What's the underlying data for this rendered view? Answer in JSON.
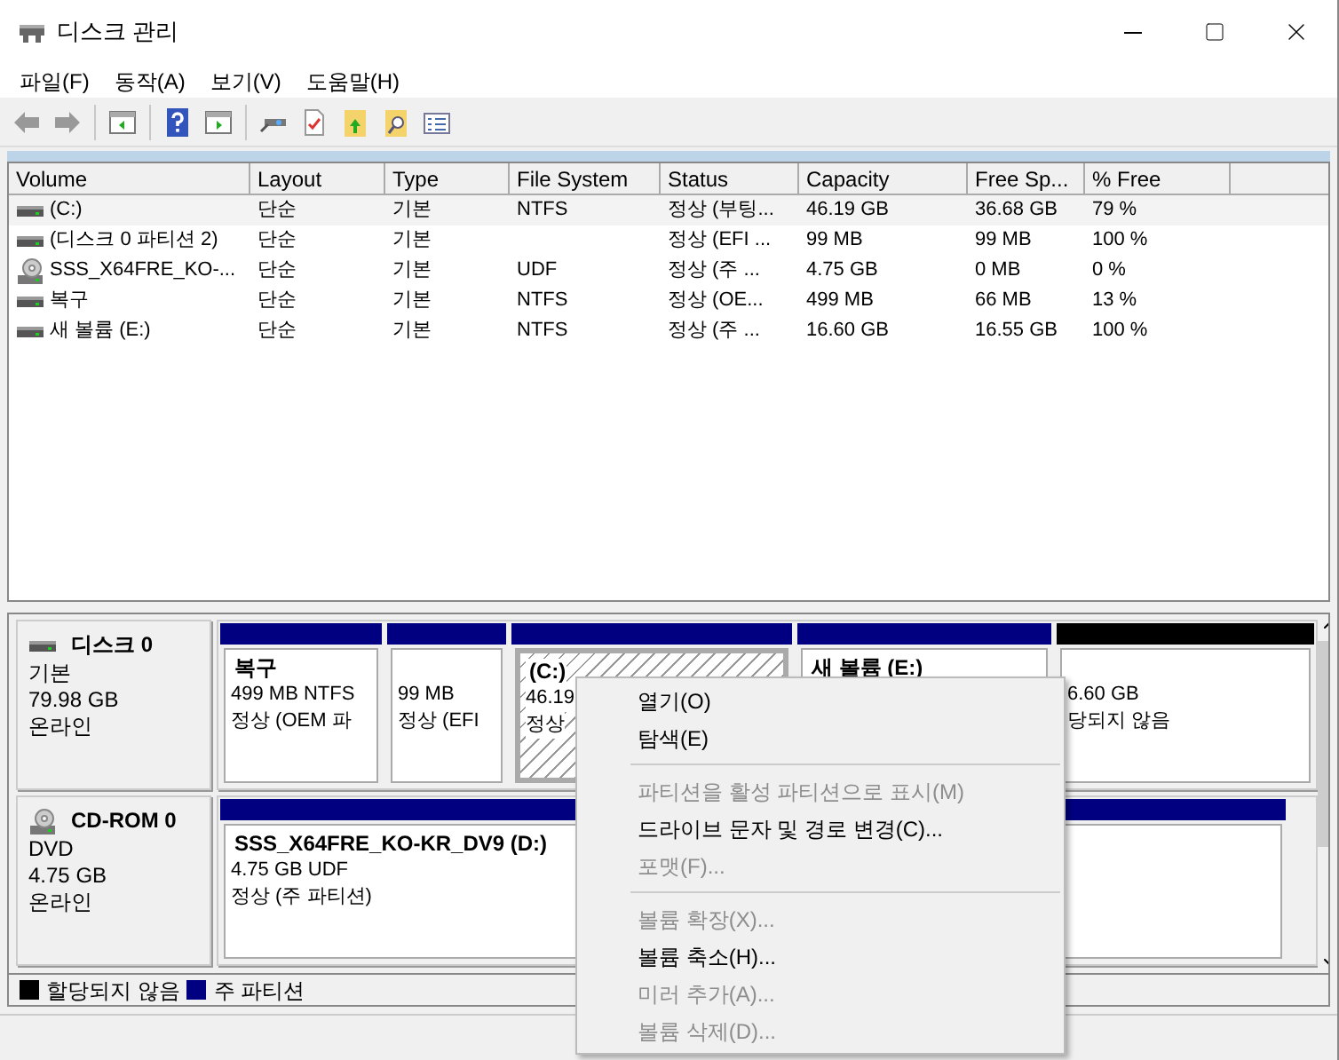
{
  "window": {
    "title": "디스크 관리"
  },
  "menu": [
    "파일(F)",
    "동작(A)",
    "보기(V)",
    "도움말(H)"
  ],
  "table": {
    "columns": [
      "Volume",
      "Layout",
      "Type",
      "File System",
      "Status",
      "Capacity",
      "Free Sp...",
      "% Free"
    ],
    "rows": [
      {
        "kind": "disk",
        "selected": true,
        "cells": [
          "(C:)",
          "단순",
          "기본",
          "NTFS",
          "정상 (부팅...",
          "46.19 GB",
          "36.68 GB",
          "79 %"
        ]
      },
      {
        "kind": "disk",
        "selected": false,
        "cells": [
          "(디스크 0 파티션 2)",
          "단순",
          "기본",
          "",
          "정상 (EFI ...",
          "99 MB",
          "99 MB",
          "100 %"
        ]
      },
      {
        "kind": "cd",
        "selected": false,
        "cells": [
          "SSS_X64FRE_KO-...",
          "단순",
          "기본",
          "UDF",
          "정상 (주 ...",
          "4.75 GB",
          "0 MB",
          "0 %"
        ]
      },
      {
        "kind": "disk",
        "selected": false,
        "cells": [
          "복구",
          "단순",
          "기본",
          "NTFS",
          "정상 (OE...",
          "499 MB",
          "66 MB",
          "13 %"
        ]
      },
      {
        "kind": "disk",
        "selected": false,
        "cells": [
          "새 볼륨 (E:)",
          "단순",
          "기본",
          "NTFS",
          "정상 (주 ...",
          "16.60 GB",
          "16.55 GB",
          "100 %"
        ]
      }
    ]
  },
  "disks": [
    {
      "kind": "disk",
      "name": "디스크 0",
      "type": "기본",
      "size": "79.98 GB",
      "status": "온라인",
      "partitions": [
        {
          "kind": "primary",
          "selected": false,
          "title": "복구",
          "size": "499 MB NTFS",
          "status": "정상 (OEM 파"
        },
        {
          "kind": "primary",
          "selected": false,
          "size": "99 MB",
          "status": "정상 (EFI"
        },
        {
          "kind": "primary",
          "selected": true,
          "title": "(C:)",
          "size": "46.19",
          "status": "정상"
        },
        {
          "kind": "primary",
          "selected": false,
          "title": "새 볼륨 (E:)"
        },
        {
          "kind": "unallocated",
          "selected": false,
          "size": "6.60 GB",
          "status": "당되지 않음"
        }
      ]
    },
    {
      "kind": "cd",
      "name": "CD-ROM 0",
      "type": "DVD",
      "size": "4.75 GB",
      "status": "온라인",
      "partitions": [
        {
          "kind": "primary",
          "selected": false,
          "title": "SSS_X64FRE_KO-KR_DV9  (D:)",
          "size": "4.75 GB UDF",
          "status": "정상 (주 파티션)"
        }
      ]
    }
  ],
  "legend": [
    {
      "label": "할당되지 않음",
      "color": "#000000"
    },
    {
      "label": "주 파티션",
      "color": "#000080"
    }
  ],
  "context_menu": [
    {
      "kind": "item",
      "label": "열기(O)",
      "disabled": false
    },
    {
      "kind": "item",
      "label": "탐색(E)",
      "disabled": false
    },
    {
      "kind": "separator"
    },
    {
      "kind": "item",
      "label": "파티션을 활성 파티션으로 표시(M)",
      "disabled": true
    },
    {
      "kind": "item",
      "label": "드라이브 문자 및 경로 변경(C)...",
      "disabled": false
    },
    {
      "kind": "item",
      "label": "포맷(F)...",
      "disabled": true
    },
    {
      "kind": "separator"
    },
    {
      "kind": "item",
      "label": "볼륨 확장(X)...",
      "disabled": true
    },
    {
      "kind": "item",
      "label": "볼륨 축소(H)...",
      "disabled": false
    },
    {
      "kind": "item",
      "label": "미러 추가(A)...",
      "disabled": true
    },
    {
      "kind": "item",
      "label": "볼륨 삭제(D)...",
      "disabled": true
    }
  ]
}
